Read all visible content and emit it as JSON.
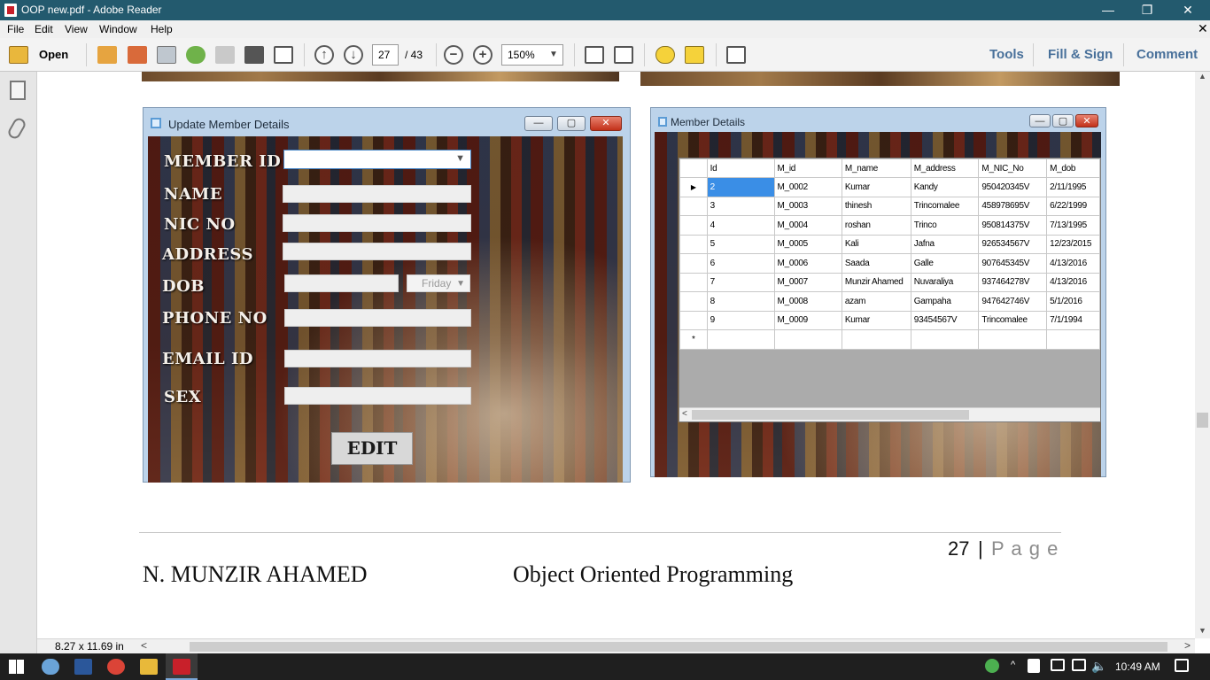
{
  "window": {
    "title": "OOP new.pdf - Adobe Reader",
    "min": "—",
    "restore": "❐",
    "close": "✕"
  },
  "menu": [
    "File",
    "Edit",
    "View",
    "Window",
    "Help"
  ],
  "toolbar": {
    "open_label": "Open",
    "page_current": "27",
    "page_total": "/ 43",
    "zoom": "150%",
    "tools": "Tools",
    "fill_sign": "Fill & Sign",
    "comment": "Comment"
  },
  "update_form": {
    "title": "Update Member Details",
    "labels": {
      "member_id": "MEMBER ID",
      "name": "NAME",
      "nic_no": "NIC NO",
      "address": "ADDRESS",
      "dob": "DOB",
      "phone_no": "PHONE NO",
      "email_id": "EMAIL ID",
      "sex": "SEX"
    },
    "date_value": "Friday",
    "edit_label": "EDIT"
  },
  "member_details": {
    "title": "Member Details",
    "columns": [
      "Id",
      "M_id",
      "M_name",
      "M_address",
      "M_NIC_No",
      "M_dob"
    ],
    "rows": [
      [
        "2",
        "M_0002",
        "Kumar",
        "Kandy",
        "950420345V",
        "2/11/1995"
      ],
      [
        "3",
        "M_0003",
        "thinesh",
        "Trincomalee",
        "458978695V",
        "6/22/1999"
      ],
      [
        "4",
        "M_0004",
        "roshan",
        "Trinco",
        "950814375V",
        "7/13/1995"
      ],
      [
        "5",
        "M_0005",
        "Kali",
        "Jafna",
        "926534567V",
        "12/23/2015"
      ],
      [
        "6",
        "M_0006",
        "Saada",
        "Galle",
        "907645345V",
        "4/13/2016"
      ],
      [
        "7",
        "M_0007",
        "Munzir Ahamed",
        "Nuvaraliya",
        "937464278V",
        "4/13/2016"
      ],
      [
        "8",
        "M_0008",
        "azam",
        "Gampaha",
        "947642746V",
        "5/1/2016"
      ],
      [
        "9",
        "M_0009",
        "Kumar",
        "93454567V",
        "Trincomalee",
        "7/1/1994"
      ]
    ],
    "new_row_marker": "*",
    "current_row_marker": "▶"
  },
  "page_footer": {
    "page_number": "27",
    "separator": "|",
    "page_word": "P a g e",
    "author": "N. MUNZIR AHAMED",
    "subject": "Object Oriented Programming"
  },
  "statusbar": {
    "page_size": "8.27 x 11.69 in"
  },
  "taskbar": {
    "time": "10:49 AM"
  },
  "colors": {
    "titlebar": "#235a6e",
    "accent_blue": "#48709a",
    "selection": "#3a8ee6",
    "pdf_red": "#c8202a"
  }
}
